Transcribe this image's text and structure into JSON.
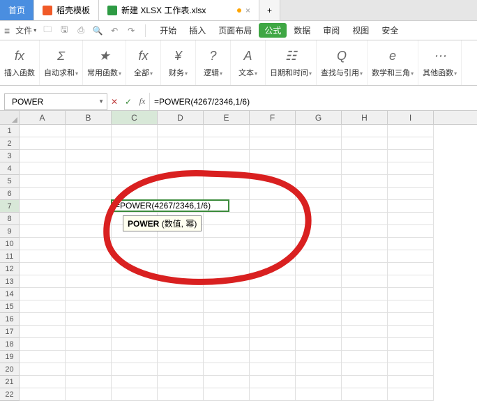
{
  "tabs": {
    "home": "首页",
    "template": "稻壳模板",
    "file": "新建 XLSX 工作表.xlsx"
  },
  "quickbar": {
    "file_menu": "文件"
  },
  "menu_tabs": [
    "开始",
    "插入",
    "页面布局",
    "公式",
    "数据",
    "审阅",
    "视图",
    "安全"
  ],
  "menu_active_index": 3,
  "ribbon": [
    {
      "icon": "fx",
      "label": "插入函数",
      "drop": false
    },
    {
      "icon": "Σ",
      "label": "自动求和",
      "drop": true
    },
    {
      "icon": "★",
      "label": "常用函数",
      "drop": true
    },
    {
      "icon": "fx",
      "label": "全部",
      "drop": true
    },
    {
      "icon": "¥",
      "label": "财务",
      "drop": true
    },
    {
      "icon": "?",
      "label": "逻辑",
      "drop": true
    },
    {
      "icon": "A",
      "label": "文本",
      "drop": true
    },
    {
      "icon": "☷",
      "label": "日期和时间",
      "drop": true
    },
    {
      "icon": "Q",
      "label": "查找与引用",
      "drop": true
    },
    {
      "icon": "e",
      "label": "数学和三角",
      "drop": true
    },
    {
      "icon": "⋯",
      "label": "其他函数",
      "drop": true
    }
  ],
  "formula_bar": {
    "name_box": "POWER",
    "input": "=POWER(4267/2346,1/6)"
  },
  "grid": {
    "columns": [
      "A",
      "B",
      "C",
      "D",
      "E",
      "F",
      "G",
      "H",
      "I"
    ],
    "rows": 22,
    "active_col": "C",
    "active_row": 7,
    "cell_text": "=POWER(4267/2346,1/6)",
    "tooltip_func": "POWER",
    "tooltip_args": " (数值, 幂)"
  }
}
